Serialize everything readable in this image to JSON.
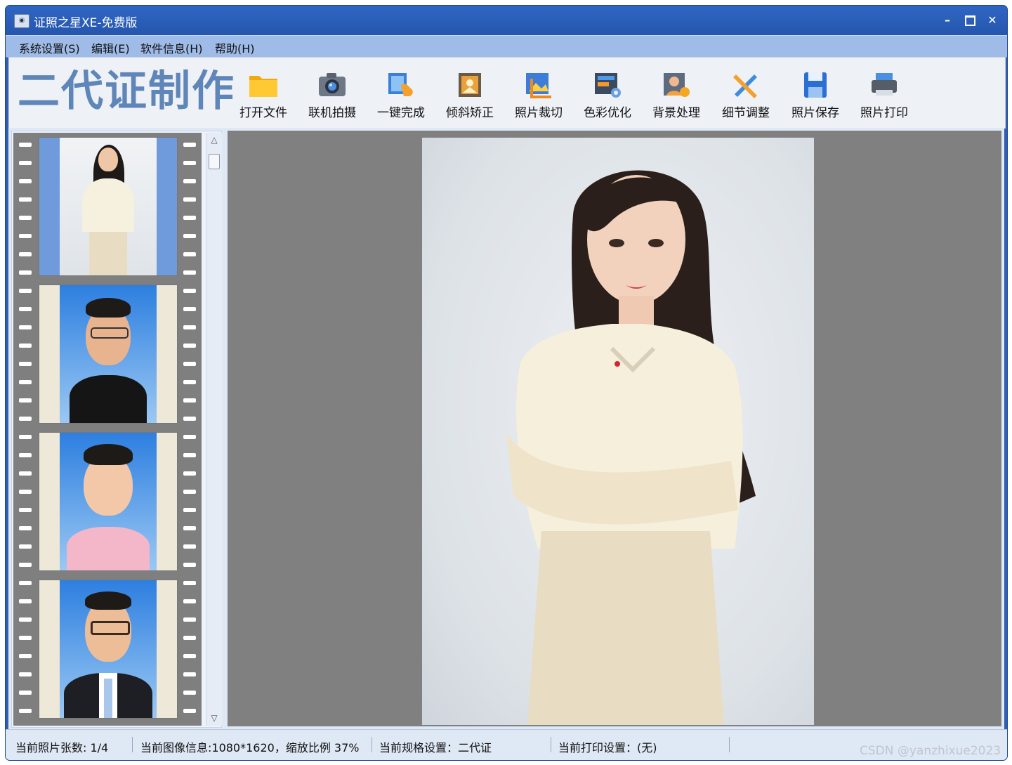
{
  "window": {
    "title": "证照之星XE-免费版"
  },
  "menu": [
    "系统设置(S)",
    "编辑(E)",
    "软件信息(H)",
    "帮助(H)"
  ],
  "toolbar": {
    "brand": "二代证制作",
    "tools": [
      {
        "label": "打开文件",
        "icon": "folder-icon"
      },
      {
        "label": "联机拍摄",
        "icon": "camera-icon"
      },
      {
        "label": "一键完成",
        "icon": "one-click-icon"
      },
      {
        "label": "倾斜矫正",
        "icon": "tilt-correction-icon"
      },
      {
        "label": "照片裁切",
        "icon": "crop-icon"
      },
      {
        "label": "色彩优化",
        "icon": "color-optimize-icon"
      },
      {
        "label": "背景处理",
        "icon": "background-icon"
      },
      {
        "label": "细节调整",
        "icon": "detail-adjust-icon"
      },
      {
        "label": "照片保存",
        "icon": "save-icon"
      },
      {
        "label": "照片打印",
        "icon": "printer-icon"
      }
    ]
  },
  "status": {
    "count": "当前照片张数: 1/4",
    "image_info": "当前图像信息:1080*1620，缩放比例 37%",
    "spec": "当前规格设置：二代证",
    "print": "当前打印设置：(无)"
  },
  "watermark": "CSDN @yanzhixue2023"
}
